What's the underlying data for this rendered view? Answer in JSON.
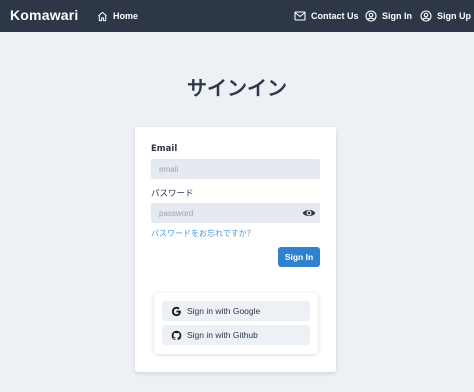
{
  "navbar": {
    "brand": "Komawari",
    "home": "Home",
    "contact": "Contact Us",
    "signin": "Sign In",
    "signup": "Sign Up"
  },
  "page": {
    "title": "サインイン"
  },
  "form": {
    "email_label": "Email",
    "email_placeholder": "email",
    "password_label": "パスワード",
    "password_placeholder": "password",
    "forgot_link": "パスワードをお忘れですか？",
    "signin_button": "Sign In"
  },
  "social": {
    "google": "Sign in with Google",
    "github": "Sign in with Github"
  },
  "colors": {
    "navbar": "#2d3748",
    "background": "#edf1f6",
    "primary": "#3182ce",
    "link": "#4299e1"
  },
  "icons": [
    "home-icon",
    "mail-icon",
    "user-circle-icon",
    "eye-icon",
    "google-icon",
    "github-icon"
  ]
}
